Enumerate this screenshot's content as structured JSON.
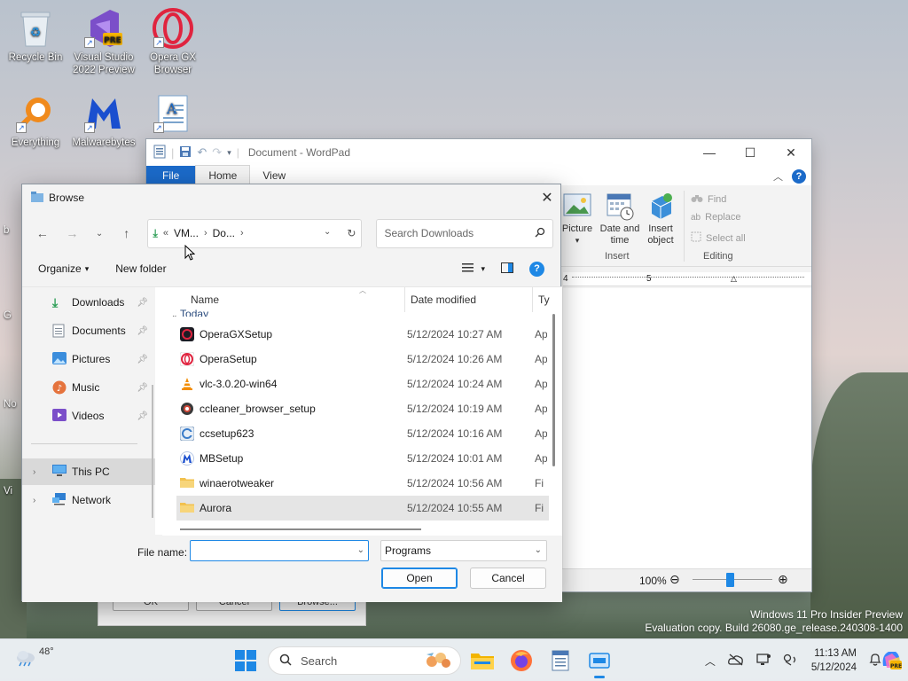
{
  "desktop": {
    "icons": [
      {
        "label": "Recycle Bin"
      },
      {
        "label": "Visual Studio 2022 Preview"
      },
      {
        "label": "Opera GX Browser"
      },
      {
        "label": "Everything"
      },
      {
        "label": "Malwarebytes"
      },
      {
        "label": ""
      }
    ],
    "edge_labels": [
      "b",
      "G",
      "No",
      "Vi"
    ]
  },
  "wordpad": {
    "title": "Document - WordPad",
    "tabs": [
      "File",
      "Home",
      "View"
    ],
    "ribbon": {
      "picture_label": "Picture",
      "datetime_label": "Date and time",
      "insert_object_label": "Insert object",
      "insert_group": "Insert",
      "find_label": "Find",
      "replace_label": "Replace",
      "select_all_label": "Select all",
      "editing_group": "Editing"
    },
    "ruler": {
      "mark_4": "4",
      "mark_5": "5"
    },
    "status": {
      "zoom": "100%"
    }
  },
  "browse_dialog": {
    "title": "Browse",
    "address": {
      "prefix": "«",
      "seg1": "VM...",
      "seg2": "Do..."
    },
    "search_placeholder": "Search Downloads",
    "toolbar": {
      "organize": "Organize",
      "new_folder": "New folder"
    },
    "nav_items": [
      {
        "label": "Downloads",
        "pinned": true
      },
      {
        "label": "Documents",
        "pinned": true
      },
      {
        "label": "Pictures",
        "pinned": true
      },
      {
        "label": "Music",
        "pinned": true
      },
      {
        "label": "Videos",
        "pinned": true
      },
      {
        "label": "This PC",
        "selected": true
      },
      {
        "label": "Network"
      }
    ],
    "columns": {
      "name": "Name",
      "date": "Date modified",
      "type": "Ty"
    },
    "group_label": "Today",
    "files": [
      {
        "name": "OperaGXSetup",
        "date": "5/12/2024 10:27 AM",
        "type": "Ap",
        "icon": "opera-gx-icon"
      },
      {
        "name": "OperaSetup",
        "date": "5/12/2024 10:26 AM",
        "type": "Ap",
        "icon": "opera-icon"
      },
      {
        "name": "vlc-3.0.20-win64",
        "date": "5/12/2024 10:24 AM",
        "type": "Ap",
        "icon": "vlc-icon"
      },
      {
        "name": "ccleaner_browser_setup",
        "date": "5/12/2024 10:19 AM",
        "type": "Ap",
        "icon": "ccleaner-browser-icon"
      },
      {
        "name": "ccsetup623",
        "date": "5/12/2024 10:16 AM",
        "type": "Ap",
        "icon": "ccleaner-icon"
      },
      {
        "name": "MBSetup",
        "date": "5/12/2024 10:01 AM",
        "type": "Ap",
        "icon": "malwarebytes-icon"
      },
      {
        "name": "winaerotweaker",
        "date": "5/12/2024 10:56 AM",
        "type": "Fi",
        "icon": "folder-icon"
      },
      {
        "name": "Aurora",
        "date": "5/12/2024 10:55 AM",
        "type": "Fi",
        "icon": "folder-icon",
        "selected": true
      }
    ],
    "file_name_label": "File name:",
    "file_name_value": "",
    "file_type_value": "Programs",
    "open_label": "Open",
    "cancel_label": "Cancel"
  },
  "behind_dialog": {
    "buttons": [
      "OK",
      "Cancel",
      "Browse..."
    ]
  },
  "watermark": {
    "line1": "Windows 11 Pro Insider Preview",
    "line2": "Evaluation copy. Build 26080.ge_release.240308-1400"
  },
  "taskbar": {
    "weather_temp": "48°",
    "search_label": "Search",
    "time": "11:13 AM",
    "date": "5/12/2024"
  },
  "colors": {
    "accent": "#1e88e5",
    "file_tab": "#1b6ac9"
  }
}
